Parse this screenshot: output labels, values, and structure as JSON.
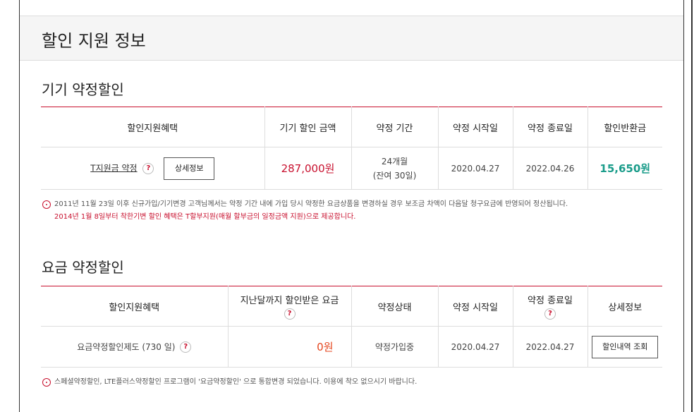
{
  "page_title": "할인 지원 정보",
  "section1": {
    "title": "기기 약정할인",
    "headers": [
      "할인지원혜택",
      "기기 할인 금액",
      "약정 기간",
      "약정 시작일",
      "약정 종료일",
      "할인반환금"
    ],
    "row": {
      "benefit": "T지원금 약정",
      "help": "?",
      "detail_button": "상세정보",
      "amount": "287,000원",
      "period_line1": "24개월",
      "period_line2": "(잔여 30일)",
      "start": "2020.04.27",
      "end": "2022.04.26",
      "refund": "15,650원"
    },
    "note_line1": "2011년 11월 23일 이후 신규가입/기기변경 고객님께서는 약정 기간 내에 가입 당시 약정한 요금상품을 변경하실 경우 보조금 차액이 다음달 청구요금에 반영되어 정산됩니다.",
    "note_line2": "2014년 1월 8일부터 착한기변 할인 혜택은 T할부지원(매월 할부금의 일정금액 지원)으로 제공합니다."
  },
  "section2": {
    "title": "요금 약정할인",
    "headers": [
      "할인지원혜택",
      "지난달까지 할인받은 요금",
      "약정상태",
      "약정 시작일",
      "약정 종료일",
      "상세정보"
    ],
    "help": "?",
    "row": {
      "benefit": "요금약정할인제도 (730 일)",
      "amount": "0원",
      "status": "약정가입중",
      "start": "2020.04.27",
      "end": "2022.04.27",
      "detail_button": "할인내역 조회"
    },
    "note": "스페셜약정할인, LTE플러스약정할인 프로그램이 '요금약정할인' 으로 통합변경 되었습니다. 이용에 착오 없으시기 바랍니다."
  },
  "colors": {
    "accent": "#c8102e",
    "green": "#1a9c8a",
    "orange": "#e4451d"
  }
}
